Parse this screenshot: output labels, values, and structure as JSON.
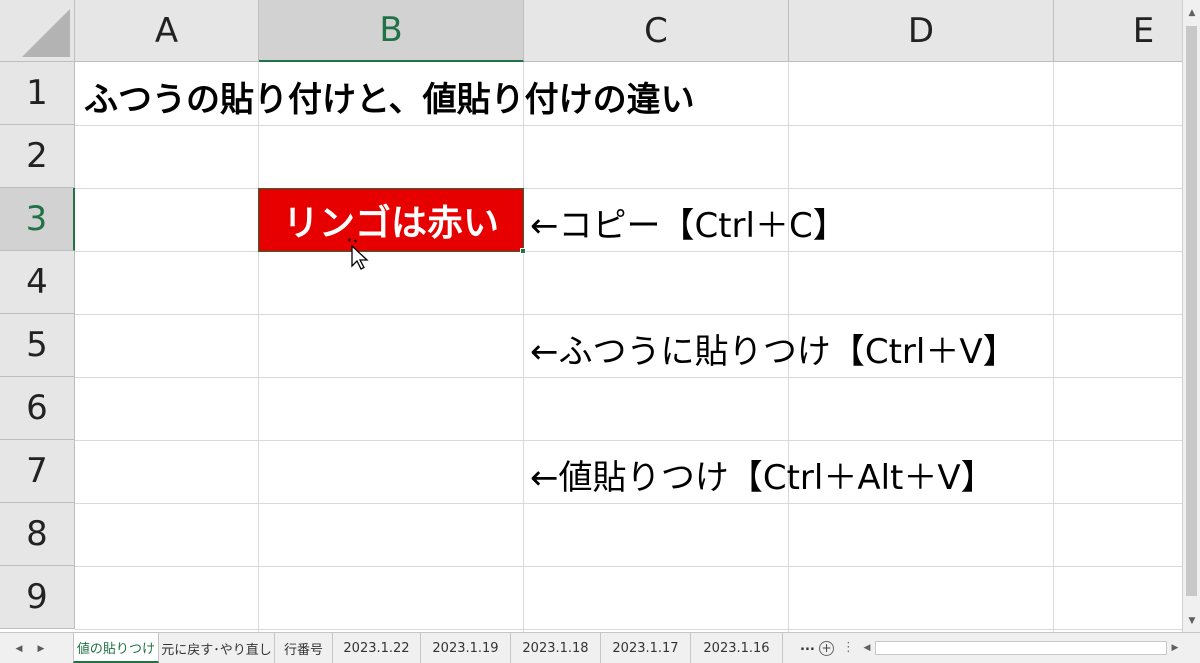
{
  "columns": [
    "A",
    "B",
    "C",
    "D",
    "E"
  ],
  "rows": [
    "1",
    "2",
    "3",
    "4",
    "5",
    "6",
    "7",
    "8",
    "9"
  ],
  "cells": {
    "A1": "ふつうの貼り付けと、値貼り付けの違い",
    "B3": "リンゴは赤い",
    "C3": "←コピー【Ctrl＋C】",
    "C5": "←ふつうに貼りつけ【Ctrl＋V】",
    "C7": "←値貼りつけ【Ctrl＋Alt＋V】"
  },
  "selected_cell": {
    "column": "B",
    "row": "3"
  },
  "colors": {
    "accent": "#217346",
    "cell_fill": "#e60000",
    "cell_text": "#ffffff"
  },
  "sheet_tabs": [
    "値の貼りつけ",
    "元に戻す･やり直し",
    "行番号",
    "2023.1.22",
    "2023.1.19",
    "2023.1.18",
    "2023.1.17",
    "2023.1.16"
  ],
  "active_tab": "値の貼りつけ",
  "tab_overflow": "...",
  "add_sheet_icon": "plus-circle-icon"
}
